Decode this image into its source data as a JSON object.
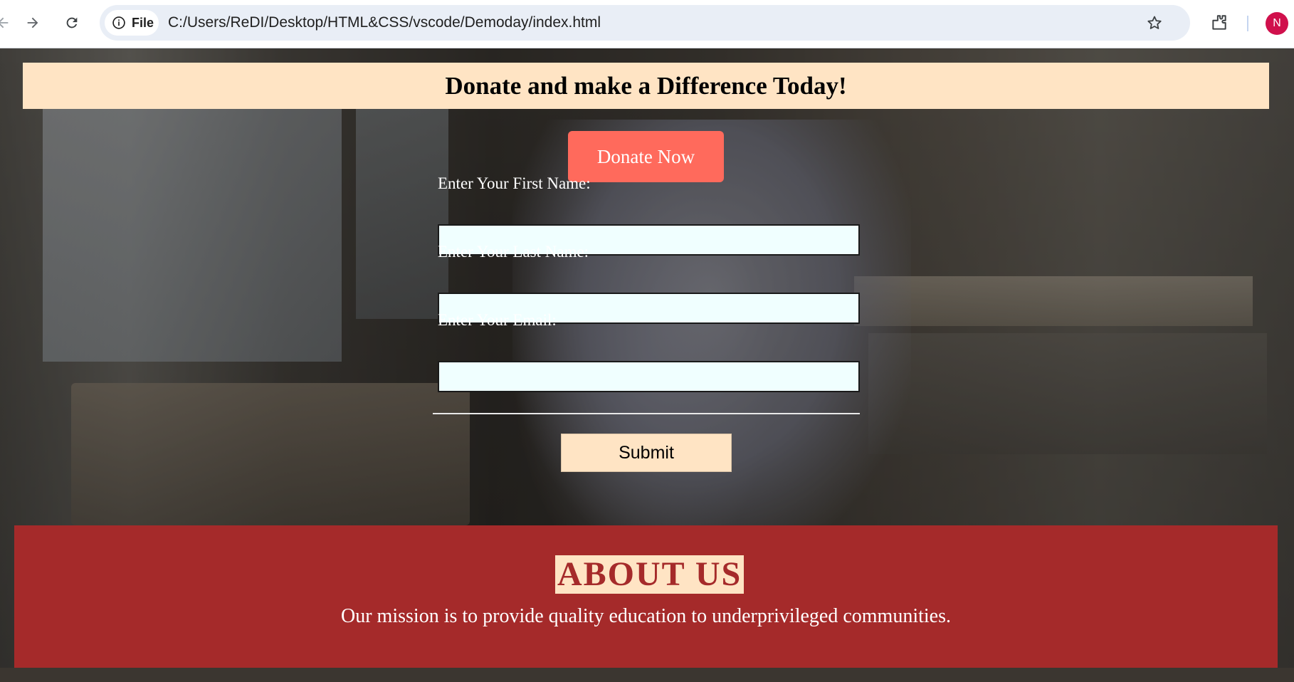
{
  "browser": {
    "chip_label": "File",
    "url": "C:/Users/ReDI/Desktop/HTML&CSS/vscode/Demoday/index.html",
    "avatar_initial": "N"
  },
  "page": {
    "banner_title": "Donate and make a Difference Today!",
    "donate_button": "Donate Now",
    "form": {
      "first_name_label": "Enter Your First Name:",
      "first_name_value": "",
      "last_name_label": "Enter Your Last Name:",
      "last_name_value": "",
      "email_label": "Enter Your Email:",
      "email_value": "",
      "submit_label": "Submit"
    },
    "about": {
      "title": "ABOUT US",
      "text": "Our mission is to provide quality education to underprivileged communities."
    }
  },
  "colors": {
    "banner_bg": "#ffe4c4",
    "donate_button_bg": "#ff6a5c",
    "input_bg": "#f0ffff",
    "about_bg": "#a52a2a",
    "avatar_bg": "#d0104c"
  },
  "icons": [
    "back-arrow-icon",
    "forward-arrow-icon",
    "reload-icon",
    "info-icon",
    "star-icon",
    "extensions-icon"
  ]
}
